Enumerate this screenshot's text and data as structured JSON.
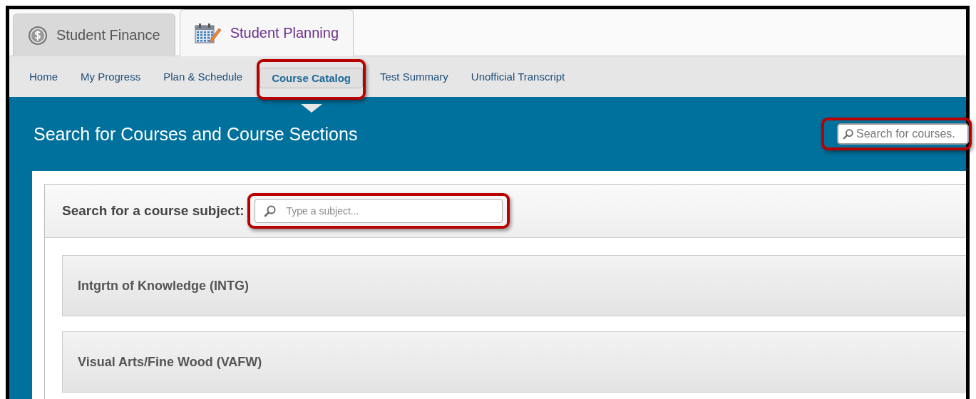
{
  "tabs": [
    {
      "label": "Student Finance",
      "selected": false
    },
    {
      "label": "Student Planning",
      "selected": true
    }
  ],
  "nav": [
    {
      "label": "Home",
      "selected": false,
      "highlighted": false
    },
    {
      "label": "My Progress",
      "selected": false,
      "highlighted": false
    },
    {
      "label": "Plan & Schedule",
      "selected": false,
      "highlighted": false
    },
    {
      "label": "Course Catalog",
      "selected": true,
      "highlighted": true
    },
    {
      "label": "Test Summary",
      "selected": false,
      "highlighted": false
    },
    {
      "label": "Unofficial Transcript",
      "selected": false,
      "highlighted": false
    }
  ],
  "header": {
    "title": "Search for Courses and Course Sections",
    "search": {
      "placeholder": "Search for courses.",
      "highlighted": true
    }
  },
  "subject_search": {
    "label": "Search for a course subject:",
    "placeholder": "Type a subject...",
    "highlighted": true
  },
  "subjects": [
    {
      "name": "Intgrtn of Knowledge (INTG)"
    },
    {
      "name": "Visual Arts/Fine Wood (VAFW)"
    }
  ]
}
